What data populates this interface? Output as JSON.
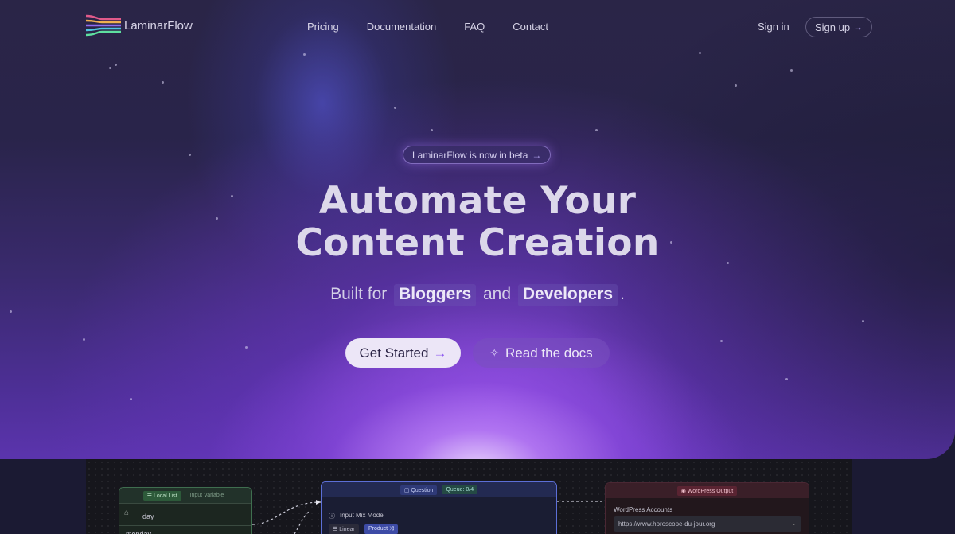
{
  "brand": {
    "name": "LaminarFlow",
    "logo_icon": "flow-lines-logo"
  },
  "nav": {
    "links": [
      "Pricing",
      "Documentation",
      "FAQ",
      "Contact"
    ],
    "sign_in": "Sign in",
    "sign_up": "Sign up"
  },
  "hero": {
    "badge": "LaminarFlow is now in beta",
    "title_line1": "Automate Your",
    "title_line2": "Content Creation",
    "subtitle_prefix": "Built for",
    "subtitle_highlight1": "Bloggers",
    "subtitle_and": "and",
    "subtitle_highlight2": "Developers",
    "subtitle_suffix": ".",
    "cta_primary": "Get Started",
    "cta_secondary": "Read the docs"
  },
  "preview": {
    "node_local_list": {
      "tag": "Local List",
      "secondary": "Input Variable",
      "row1": "day",
      "row2": "monday"
    },
    "node_question": {
      "tag": "Question",
      "queue": "Queue: 0/4",
      "label": "Input Mix Mode",
      "opt1": "Linear",
      "opt2": "Product"
    },
    "node_wordpress": {
      "tag": "WordPress Output",
      "label": "WordPress Accounts",
      "value": "https://www.horoscope-du-jour.org"
    }
  },
  "colors": {
    "accent": "#8f5cf0",
    "background": "#1b1a33",
    "button_light": "#ece6f7"
  }
}
